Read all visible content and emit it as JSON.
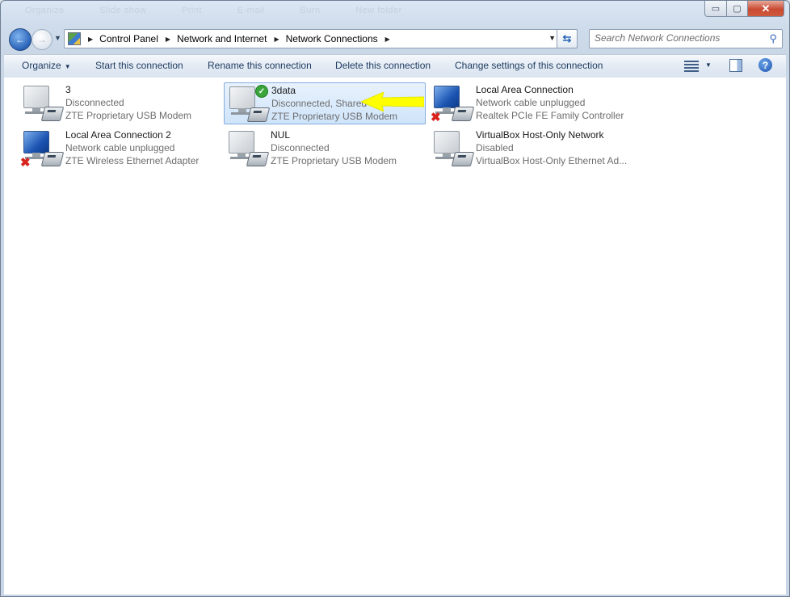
{
  "window": {
    "ghost_labels": [
      "Organize",
      "Slide show",
      "Print",
      "E-mail",
      "Burn",
      "New folder"
    ],
    "caption": {
      "minimize": "▭",
      "maximize": "▢",
      "close": "✕"
    }
  },
  "nav": {
    "breadcrumb": [
      "Control Panel",
      "Network and Internet",
      "Network Connections"
    ],
    "search_placeholder": "Search Network Connections"
  },
  "toolbar": {
    "organize": "Organize",
    "start": "Start this connection",
    "rename": "Rename this connection",
    "delete": "Delete this connection",
    "change": "Change settings of this connection",
    "help": "?"
  },
  "connections": [
    {
      "name": "3",
      "status": "Disconnected",
      "device": "ZTE Proprietary USB Modem"
    },
    {
      "name": "3data",
      "status": "Disconnected, Shared",
      "device": "ZTE Proprietary USB Modem"
    },
    {
      "name": "Local Area Connection",
      "status": "Network cable unplugged",
      "device": "Realtek PCIe FE Family Controller"
    },
    {
      "name": "Local Area Connection 2",
      "status": "Network cable unplugged",
      "device": "ZTE Wireless Ethernet Adapter"
    },
    {
      "name": "NUL",
      "status": "Disconnected",
      "device": "ZTE Proprietary USB Modem"
    },
    {
      "name": "VirtualBox Host-Only Network",
      "status": "Disabled",
      "device": "VirtualBox Host-Only Ethernet Ad..."
    }
  ],
  "icons": {
    "dialup": "dialup-connection-icon",
    "lan": "lan-connection-icon",
    "check": "shared-check-icon",
    "disconnected": "red-x-icon",
    "arrow": "yellow-arrow-annotation"
  },
  "colors": {
    "accent": "#2a63b8",
    "selected_bg": "#cfe4fa",
    "arrow": "#ffff00",
    "error": "#d8221d"
  }
}
